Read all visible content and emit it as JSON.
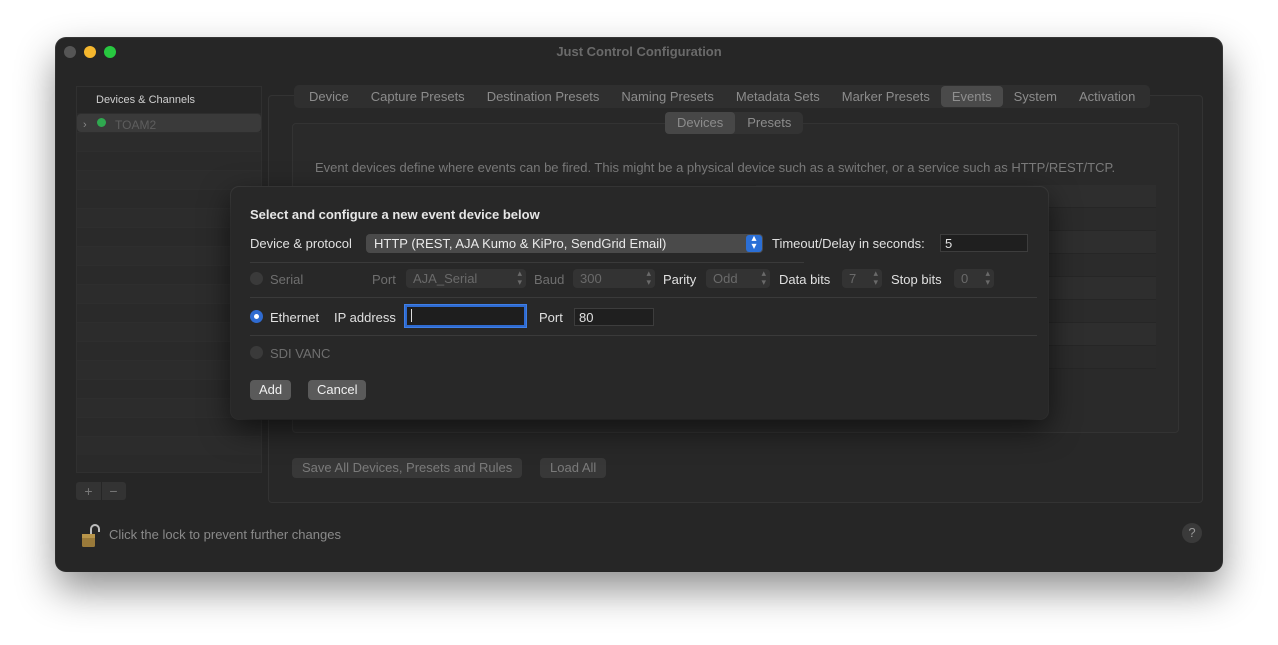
{
  "window": {
    "title": "Just Control Configuration"
  },
  "sidebar": {
    "header": "Devices & Channels",
    "items": [
      {
        "label": "TOAM2",
        "status_color": "#2fa84f"
      }
    ],
    "add_label": "+",
    "remove_label": "−"
  },
  "tabs": [
    {
      "label": "Device"
    },
    {
      "label": "Capture Presets"
    },
    {
      "label": "Destination Presets"
    },
    {
      "label": "Naming Presets"
    },
    {
      "label": "Metadata Sets"
    },
    {
      "label": "Marker Presets"
    },
    {
      "label": "Events",
      "active": true
    },
    {
      "label": "System"
    },
    {
      "label": "Activation"
    }
  ],
  "subtabs": [
    {
      "label": "Devices",
      "active": true
    },
    {
      "label": "Presets"
    }
  ],
  "description": "Event devices define where events can be fired. This might be a physical device such as a switcher, or a service such as HTTP/REST/TCP.",
  "bottom": {
    "save_all": "Save All Devices, Presets and Rules",
    "load_all": "Load All"
  },
  "lock": {
    "text": "Click the lock to prevent further changes"
  },
  "help": {
    "label": "?"
  },
  "dialog": {
    "title": "Select and configure a new event device below",
    "device_protocol_label": "Device & protocol",
    "device_protocol_value": "HTTP (REST, AJA Kumo & KiPro, SendGrid Email)",
    "timeout_label": "Timeout/Delay in seconds:",
    "timeout_value": "5",
    "serial": {
      "label": "Serial",
      "port_label": "Port",
      "port_value": "AJA_Serial",
      "baud_label": "Baud",
      "baud_value": "300",
      "parity_label": "Parity",
      "parity_value": "Odd",
      "databits_label": "Data bits",
      "databits_value": "7",
      "stopbits_label": "Stop bits",
      "stopbits_value": "0"
    },
    "ethernet": {
      "label": "Ethernet",
      "ip_label": "IP address",
      "ip_value": "",
      "port_label": "Port",
      "port_value": "80"
    },
    "sdi": {
      "label": "SDI VANC"
    },
    "add_label": "Add",
    "cancel_label": "Cancel"
  },
  "colors": {
    "accent": "#2f6bd1",
    "status_green": "#2fa84f"
  }
}
